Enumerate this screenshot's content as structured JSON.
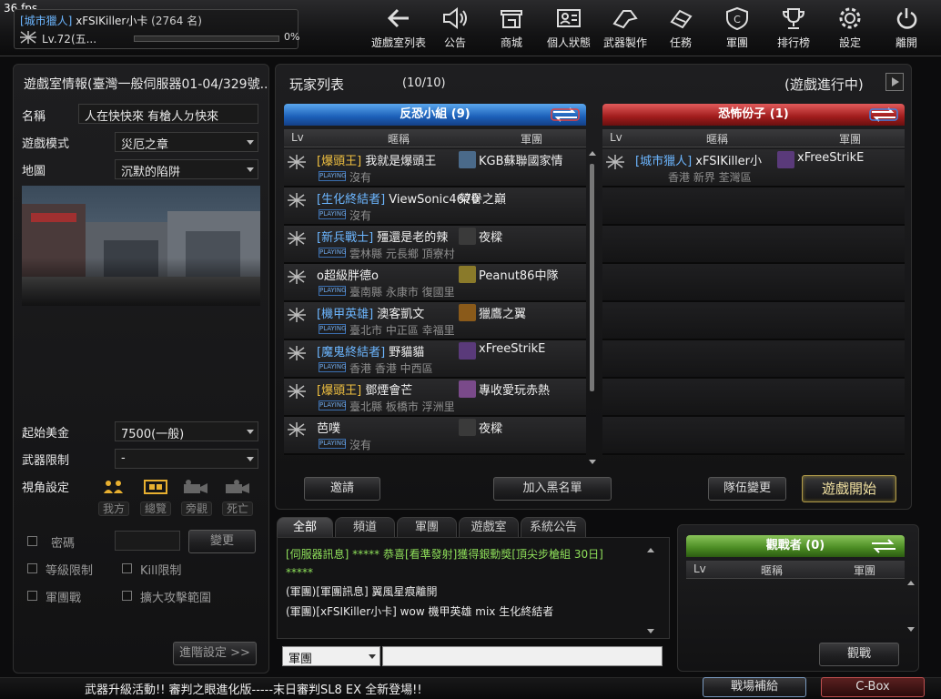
{
  "fps": "36 fps",
  "player": {
    "title": "[城市獵人]",
    "name": "xFSIKiller小卡",
    "count": "(2764 名)",
    "level": "Lv.72(五...",
    "exp_percent": 0,
    "exp_label": "0%"
  },
  "nav": [
    {
      "label": "遊戲室列表",
      "icon": "back-arrow-icon"
    },
    {
      "label": "公告",
      "icon": "speaker-icon"
    },
    {
      "label": "商城",
      "icon": "shop-icon"
    },
    {
      "label": "個人狀態",
      "icon": "profile-card-icon"
    },
    {
      "label": "武器製作",
      "icon": "weapon-craft-icon"
    },
    {
      "label": "任務",
      "icon": "mission-icon"
    },
    {
      "label": "軍團",
      "icon": "clan-icon"
    },
    {
      "label": "排行榜",
      "icon": "trophy-icon"
    },
    {
      "label": "設定",
      "icon": "gear-icon"
    },
    {
      "label": "離開",
      "icon": "power-icon"
    }
  ],
  "room": {
    "header": "遊戲室情報(臺灣一般伺服器01-04/329號...",
    "name_label": "名稱",
    "name_value": "人在快快來 有槍人ㄉ快來",
    "mode_label": "遊戲模式",
    "mode_value": "災厄之章",
    "map_label": "地圖",
    "map_value": "沉默的陷阱",
    "money_label": "起始美金",
    "money_value": "7500(一般)",
    "weapon_label": "武器限制",
    "weapon_value": "-",
    "view_label": "視角設定",
    "views": [
      "我方",
      "總覽",
      "旁觀",
      "死亡"
    ],
    "password_label": "密碼",
    "change_button": "變更",
    "level_limit_label": "等級限制",
    "kill_limit_label": "Kill限制",
    "clan_war_label": "軍團戰",
    "expand_attack_label": "擴大攻擊範圍",
    "advanced_button": "進階設定 >>"
  },
  "player_list": {
    "title": "玩家列表",
    "count": "(10/10)",
    "status": "(遊戲進行中)",
    "columns": {
      "lv": "Lv",
      "nick": "暱稱",
      "clan": "軍團"
    },
    "team_a": {
      "name": "反恐小組 (9)",
      "players": [
        {
          "title": "[爆頭王]",
          "title_color": "gold",
          "name": "我就是爆頭王",
          "clan": "KGB蘇聯國家情",
          "clan_icon": "#4a6a8a",
          "badge": "PLAYING",
          "location": "沒有"
        },
        {
          "title": "[生化終結者]",
          "title_color": "blue",
          "name": "ViewSonic4670",
          "clan": "榮譽之巔",
          "clan_icon": "",
          "badge": "PLAYING",
          "location": "沒有"
        },
        {
          "title": "[新兵戰士]",
          "title_color": "blue",
          "name": "殭還是老的辣",
          "clan": "夜樑",
          "clan_icon": "#3a3a3a",
          "badge": "PLAYING",
          "location": "雲林縣  元長鄉  頂寮村"
        },
        {
          "title": "",
          "title_color": "blue",
          "name": "o超級胖德o",
          "clan": "Peanut86中隊",
          "clan_icon": "#8a7a2a",
          "badge": "PLAYING",
          "location": "臺南縣  永康市  復國里"
        },
        {
          "title": "[機甲英雄]",
          "title_color": "blue",
          "name": "澳客凱文",
          "clan": "獵鷹之翼",
          "clan_icon": "#8a5a1a",
          "badge": "PLAYING",
          "location": "臺北市  中正區  幸福里"
        },
        {
          "title": "[魔鬼終結者]",
          "title_color": "blue",
          "name": "野貓貓",
          "clan": "xFreeStrikE",
          "clan_icon": "#5a3a7a",
          "badge": "PLAYING",
          "location": "香港  香港  中西區"
        },
        {
          "title": "[爆頭王]",
          "title_color": "gold",
          "name": "鄧煙會芒",
          "clan": "專收愛玩赤熱",
          "clan_icon": "#7a4a8a",
          "badge": "PLAYING",
          "location": "臺北縣  板橋市  浮洲里"
        },
        {
          "title": "",
          "title_color": "blue",
          "name": "芭噗",
          "clan": "夜樑",
          "clan_icon": "#3a3a3a",
          "badge": "PLAYING",
          "location": "沒有"
        }
      ]
    },
    "team_b": {
      "name": "恐怖份子 (1)",
      "players": [
        {
          "title": "[城市獵人]",
          "title_color": "blue",
          "name": "xFSIKiller小",
          "clan": "xFreeStrikE",
          "clan_icon": "#5a3a7a",
          "badge": "",
          "location": "香港  新界  荃灣區"
        }
      ]
    },
    "invite_button": "邀請",
    "blacklist_button": "加入黑名單",
    "team_change_button": "隊伍變更",
    "start_button": "遊戲開始"
  },
  "chat": {
    "tabs": [
      "全部",
      "頻道",
      "軍團",
      "遊戲室",
      "系統公告"
    ],
    "lines": [
      {
        "text": "[伺服器訊息] ***** 恭喜[看準發射]獲得銀勳獎[頂尖步槍組 30日]",
        "color": "#8fe05a"
      },
      {
        "text": "*****",
        "color": "#8fe05a"
      },
      {
        "text": "(軍團)[軍團訊息] 翼風星痕離開",
        "color": "#e8e8e8"
      },
      {
        "text": "(軍團)[xFSIKiller小卡] wow 機甲英雄 mix 生化終結者",
        "color": "#e8e8e8"
      }
    ],
    "channel_select": "軍團",
    "input_value": ""
  },
  "spectators": {
    "header": "觀戰者 (0)",
    "columns": {
      "lv": "Lv",
      "nick": "暱稱",
      "clan": "軍團"
    },
    "watch_button": "觀戰"
  },
  "footer": {
    "ticker": "武器升級活動!! 審判之眼進化版-----末日審判SL8 EX 全新登場!!",
    "supply_button": "戰場補給",
    "cbox_button": "C-Box"
  },
  "colors": {
    "blue_team": "#1c5fb8",
    "red_team": "#a01c1c",
    "title_blue": "#6cb6ff",
    "title_gold": "#f0c040"
  }
}
